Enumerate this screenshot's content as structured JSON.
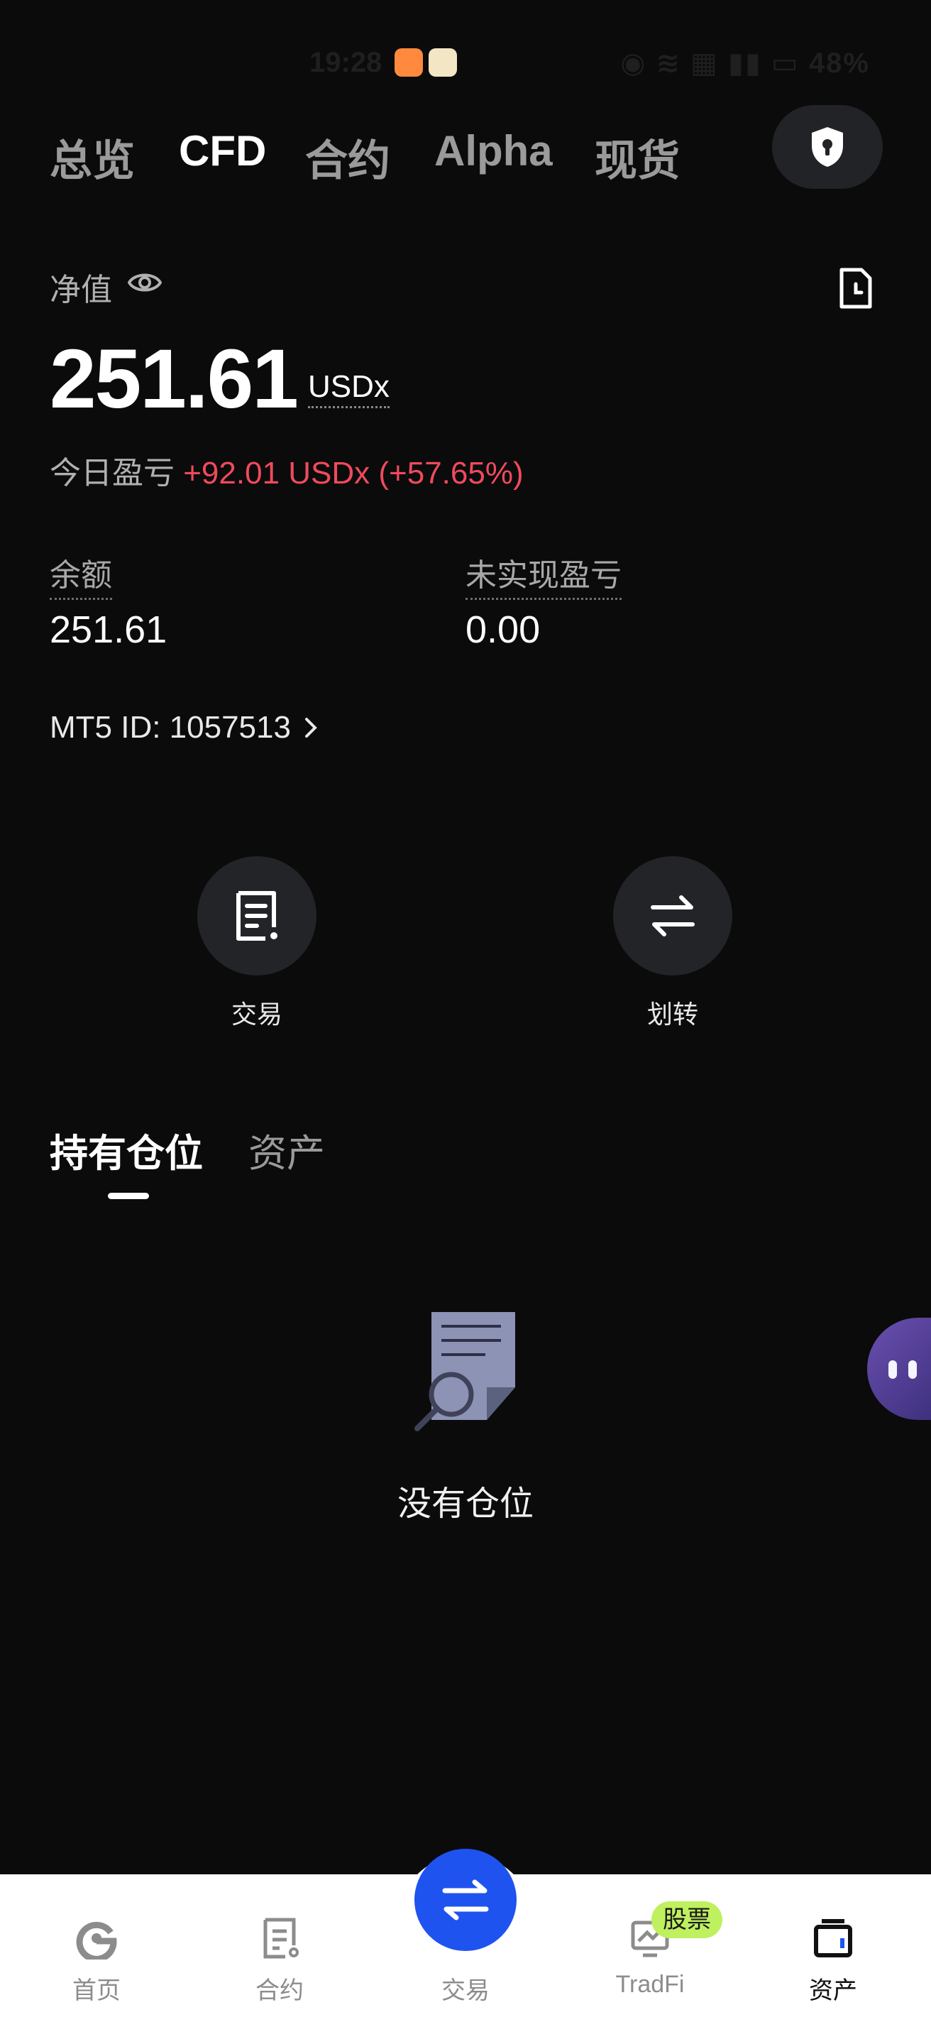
{
  "status_bar": {
    "time": "19:28",
    "battery": "48%"
  },
  "top_tabs": [
    "总览",
    "CFD",
    "合约",
    "Alpha",
    "现货"
  ],
  "active_tab_index": 1,
  "equity": {
    "label": "净值",
    "value": "251.61",
    "unit": "USDx",
    "today_pnl_label": "今日盈亏",
    "today_pnl_value": "+92.01 USDx (+57.65%)"
  },
  "stats": {
    "balance_label": "余额",
    "balance_value": "251.61",
    "unrealized_label": "未实现盈亏",
    "unrealized_value": "0.00"
  },
  "mt5_id": "MT5 ID: 1057513",
  "actions": {
    "trade": "交易",
    "transfer": "划转"
  },
  "position_tabs": [
    "持有仓位",
    "资产"
  ],
  "empty_state": "没有仓位",
  "bottom_nav": {
    "home": "首页",
    "contract": "合约",
    "trade": "交易",
    "tradfi": "TradFi",
    "tradfi_badge": "股票",
    "assets": "资产"
  },
  "colors": {
    "positive_pnl": "#f04a5c",
    "primary_blue": "#1f53f0",
    "badge_green": "#bff05f"
  }
}
